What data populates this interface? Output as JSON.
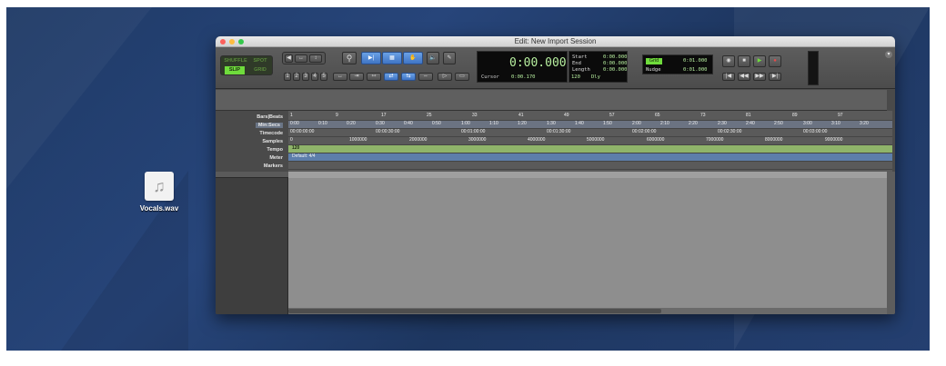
{
  "desktop": {
    "file_name": "Vocals.wav",
    "file_icon": "music-note-icon"
  },
  "window": {
    "title": "Edit: New Import Session",
    "modes": [
      "SHUFFLE",
      "SPOT",
      "SLIP",
      "GRID"
    ],
    "zoom_presets": [
      "1",
      "2",
      "3",
      "4",
      "5"
    ],
    "main_counter": "0:00.000",
    "selection": {
      "start_label": "Start",
      "end_label": "End",
      "length_label": "Length",
      "start": "0:00.000",
      "end": "0:00.000",
      "length": "0:00.000"
    },
    "cursor": {
      "label": "Cursor",
      "value": "0:00.170",
      "tempo": "120",
      "dly": "Dly"
    },
    "grid": {
      "label": "Grid",
      "value": "0:01.000"
    },
    "nudge": {
      "label": "Nudge",
      "value": "0:01.000"
    }
  },
  "rulers": {
    "labels": [
      "Bars|Beats",
      "Min:Secs",
      "Timecode",
      "Samples",
      "Tempo",
      "Meter",
      "Markers"
    ],
    "bars": [
      "1",
      "9",
      "17",
      "25",
      "33",
      "41",
      "49",
      "57",
      "65",
      "73",
      "81",
      "89",
      "97"
    ],
    "minsecs": [
      "0:00",
      "0:10",
      "0:20",
      "0:30",
      "0:40",
      "0:50",
      "1:00",
      "1:10",
      "1:20",
      "1:30",
      "1:40",
      "1:50",
      "2:00",
      "2:10",
      "2:20",
      "2:30",
      "2:40",
      "2:50",
      "3:00",
      "3:10",
      "3:20"
    ],
    "timecode": [
      "00:00:00:00",
      "00:00:30:00",
      "00:01:00:00",
      "00:01:30:00",
      "00:02:00:00",
      "00:02:30:00",
      "00:03:00:00"
    ],
    "samples": [
      "0",
      "1000000",
      "2000000",
      "3000000",
      "4000000",
      "5000000",
      "6000000",
      "7000000",
      "8000000",
      "9000000"
    ],
    "tempo_value": "120",
    "meter_value": "Default: 4/4"
  }
}
